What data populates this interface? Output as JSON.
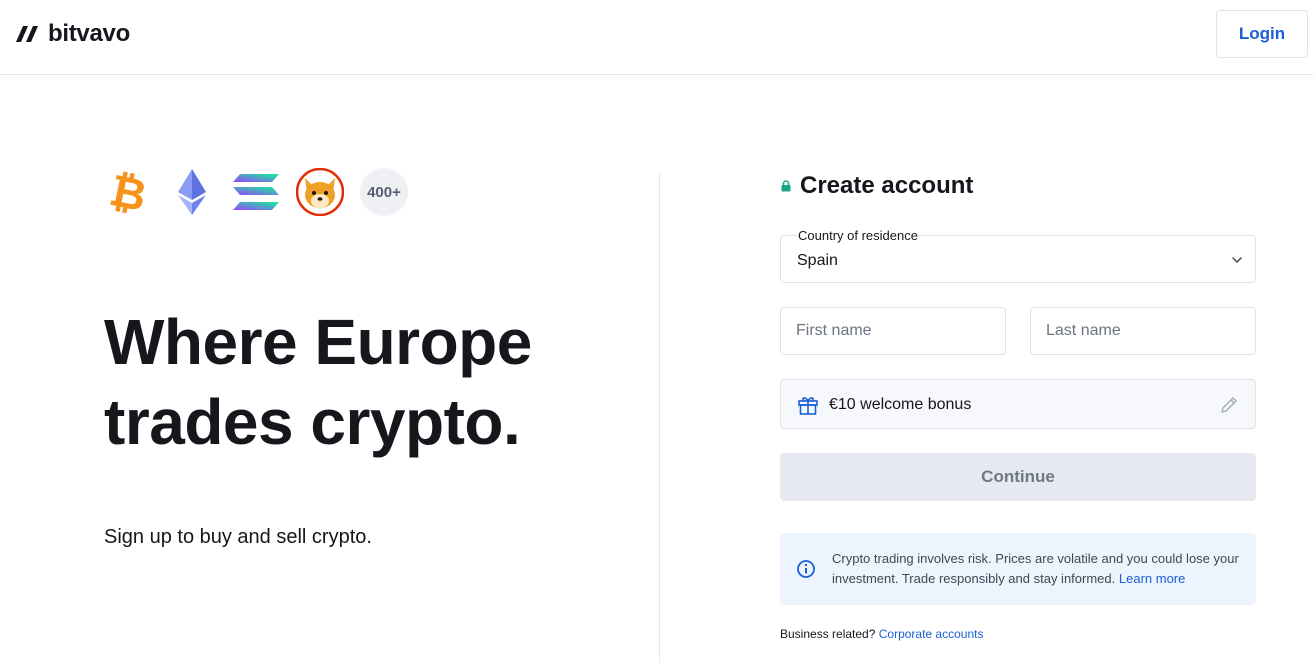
{
  "header": {
    "brand": "bitvavo",
    "login_label": "Login"
  },
  "hero": {
    "coins": [
      "bitcoin-icon",
      "ethereum-icon",
      "solana-icon",
      "shiba-inu-icon"
    ],
    "coin_count": "400+",
    "title_line1": "Where Europe",
    "title_line2": "trades crypto.",
    "subtitle": "Sign up to buy and sell crypto."
  },
  "form": {
    "title": "Create account",
    "country_label": "Country of residence",
    "country_value": "Spain",
    "first_name_placeholder": "First name",
    "last_name_placeholder": "Last name",
    "bonus_text": "€10 welcome bonus",
    "continue_label": "Continue",
    "risk_text": "Crypto trading involves risk. Prices are volatile and you could lose your investment. Trade responsibly and stay informed.",
    "risk_link": "Learn more",
    "business_prefix": "Business related?",
    "business_link": "Corporate accounts"
  },
  "colors": {
    "brand_text": "#15171c",
    "link": "#1a5fd6",
    "bitcoin": "#f7931a",
    "ethereum": "#7b8cf0",
    "lock": "#17a58a",
    "button_disabled_bg": "#e6eaf0",
    "info_bg": "#eef4fd"
  }
}
